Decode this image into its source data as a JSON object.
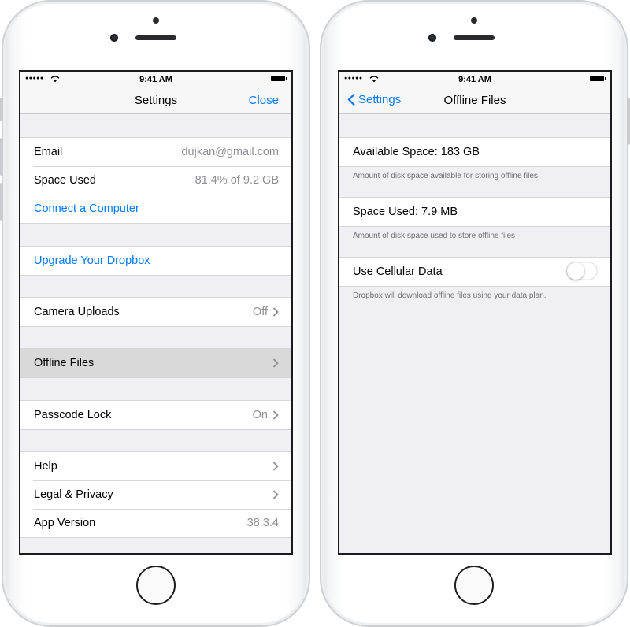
{
  "status_bar": {
    "time": "9:41 AM",
    "signal": "●●●●●"
  },
  "left_screen": {
    "nav_title": "Settings",
    "close_label": "Close",
    "email_label": "Email",
    "email_value": "dujkan@gmail.com",
    "space_used_label": "Space Used",
    "space_used_value": "81.4% of 9.2 GB",
    "connect_label": "Connect a Computer",
    "upgrade_label": "Upgrade Your Dropbox",
    "camera_uploads_label": "Camera Uploads",
    "camera_uploads_value": "Off",
    "offline_files_label": "Offline Files",
    "passcode_label": "Passcode Lock",
    "passcode_value": "On",
    "help_label": "Help",
    "legal_label": "Legal & Privacy",
    "app_version_label": "App Version",
    "app_version_value": "38.3.4"
  },
  "right_screen": {
    "back_label": "Settings",
    "nav_title": "Offline Files",
    "available_space": "Available Space: 183 GB",
    "available_space_note": "Amount of disk space available for storing offline files",
    "space_used": "Space Used: 7.9 MB",
    "space_used_note": "Amount of disk space used to store offline files",
    "cellular_label": "Use Cellular Data",
    "cellular_enabled": false,
    "cellular_note": "Dropbox will download offline files using your data plan."
  },
  "colors": {
    "accent": "#007aff",
    "background": "#efeff4",
    "secondary_text": "#8e8e93"
  },
  "icons": [
    "wifi-icon",
    "battery-icon",
    "chevron-right-icon",
    "chevron-left-icon",
    "toggle-switch"
  ]
}
